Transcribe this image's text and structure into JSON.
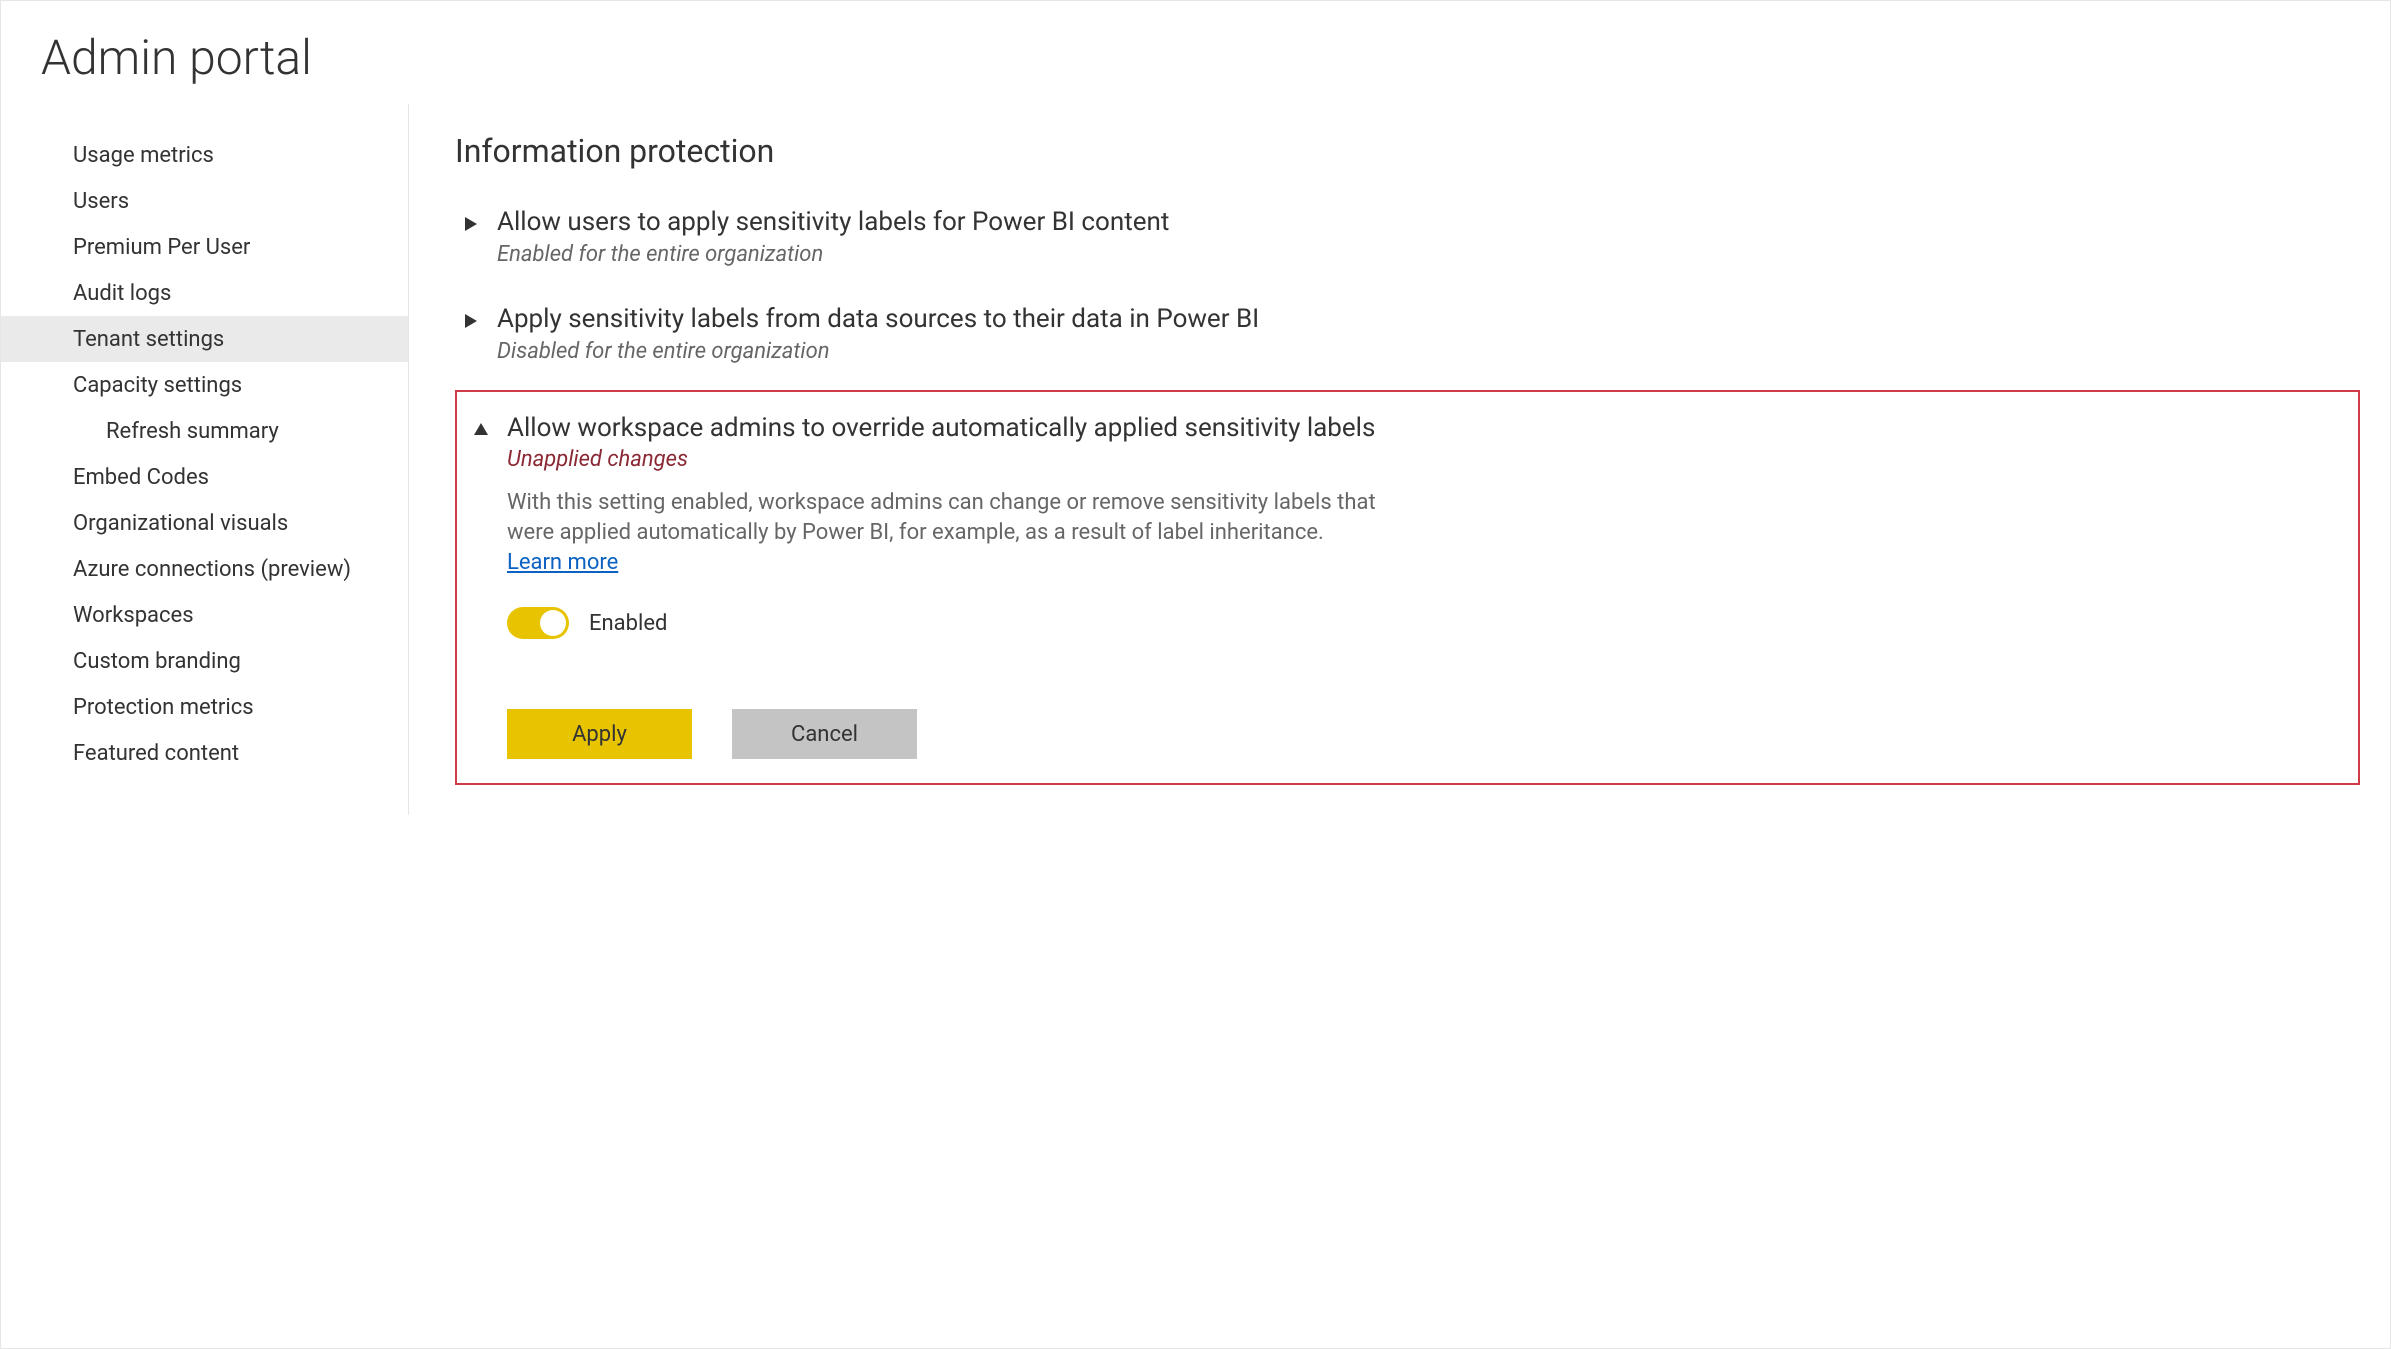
{
  "page_title": "Admin portal",
  "sidebar": {
    "items": [
      {
        "label": "Usage metrics",
        "selected": false
      },
      {
        "label": "Users",
        "selected": false
      },
      {
        "label": "Premium Per User",
        "selected": false
      },
      {
        "label": "Audit logs",
        "selected": false
      },
      {
        "label": "Tenant settings",
        "selected": true
      },
      {
        "label": "Capacity settings",
        "selected": false
      },
      {
        "label": "Refresh summary",
        "selected": false,
        "sub": true
      },
      {
        "label": "Embed Codes",
        "selected": false
      },
      {
        "label": "Organizational visuals",
        "selected": false
      },
      {
        "label": "Azure connections (preview)",
        "selected": false
      },
      {
        "label": "Workspaces",
        "selected": false
      },
      {
        "label": "Custom branding",
        "selected": false
      },
      {
        "label": "Protection metrics",
        "selected": false
      },
      {
        "label": "Featured content",
        "selected": false
      }
    ]
  },
  "section": {
    "heading": "Information protection",
    "settings": [
      {
        "title": "Allow users to apply sensitivity labels for Power BI content",
        "status": "Enabled for the entire organization"
      },
      {
        "title": "Apply sensitivity labels from data sources to their data in Power BI",
        "status": "Disabled for the entire organization"
      }
    ],
    "expanded": {
      "title": "Allow workspace admins to override automatically applied sensitivity labels",
      "unapplied_label": "Unapplied changes",
      "description": "With this setting enabled, workspace admins can change or remove sensitivity labels that were applied automatically by Power BI, for example, as a result of label inheritance.",
      "learn_more": "Learn more",
      "toggle_state": "Enabled",
      "apply_label": "Apply",
      "cancel_label": "Cancel"
    }
  }
}
